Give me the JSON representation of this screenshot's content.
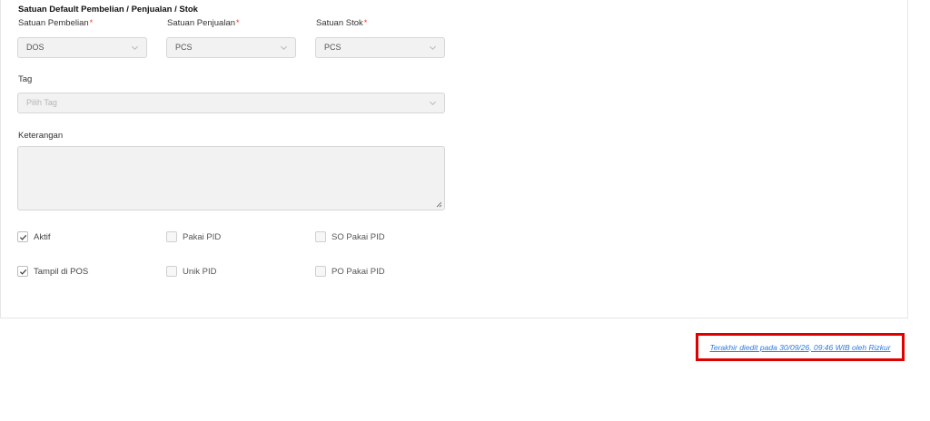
{
  "section": {
    "title": "Satuan Default Pembelian / Penjualan / Stok"
  },
  "units": {
    "purchase": {
      "label": "Satuan Pembelian",
      "required": "*",
      "value": "DOS"
    },
    "sales": {
      "label": "Satuan Penjualan",
      "required": "*",
      "value": "PCS"
    },
    "stock": {
      "label": "Satuan Stok",
      "required": "*",
      "value": "PCS"
    }
  },
  "tag": {
    "label": "Tag",
    "placeholder": "Pilih Tag"
  },
  "notes": {
    "label": "Keterangan",
    "value": ""
  },
  "checkboxes": {
    "aktif": {
      "label": "Aktif",
      "checked": true
    },
    "pakai_pid": {
      "label": "Pakai PID",
      "checked": false
    },
    "so_pakai_pid": {
      "label": "SO Pakai PID",
      "checked": false
    },
    "tampil_pos": {
      "label": "Tampil di POS",
      "checked": true
    },
    "unik_pid": {
      "label": "Unik PID",
      "checked": false
    },
    "po_pakai_pid": {
      "label": "PO Pakai PID",
      "checked": false
    }
  },
  "footer": {
    "last_edited": "Terakhir diedit pada 30/09/26, 09:46 WIB oleh Rizkur"
  },
  "colors": {
    "required": "#e53935",
    "link": "#2a7ae2",
    "highlight": "#e00000"
  },
  "icons": {
    "select": "chevron-down-icon",
    "checked": "check-icon",
    "resize": "resize-grip-icon"
  }
}
